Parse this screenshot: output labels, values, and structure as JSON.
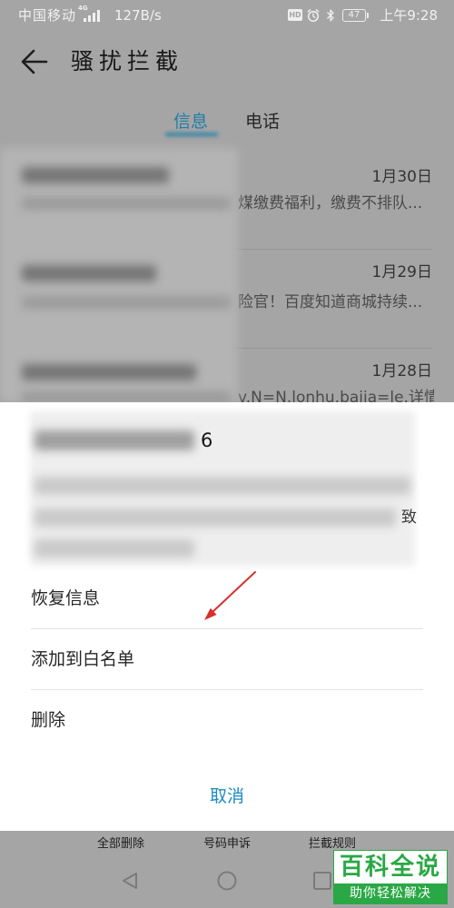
{
  "status_bar": {
    "carrier": "中国移动",
    "network": "4G",
    "speed": "127B/s",
    "hd_label": "HD",
    "battery": "47",
    "time": "上午9:28"
  },
  "header": {
    "title": "骚扰拦截"
  },
  "tabs": [
    {
      "label": "信息",
      "active": true
    },
    {
      "label": "电话",
      "active": false
    }
  ],
  "messages": [
    {
      "date": "1月30日",
      "preview": "煤缴费福利，缴费不排队..."
    },
    {
      "date": "1月29日",
      "preview": "险官！百度知道商城持续..."
    },
    {
      "date": "1月28日",
      "preview": "v.N=N.lonhu.baija=le.详情..."
    }
  ],
  "sheet": {
    "title_fragment": "6",
    "body_fragment": "致",
    "options": [
      {
        "label": "恢复信息"
      },
      {
        "label": "添加到白名单"
      },
      {
        "label": "删除"
      }
    ],
    "cancel_label": "取消"
  },
  "toolbar": {
    "items": [
      {
        "label": "全部删除"
      },
      {
        "label": "号码申诉"
      },
      {
        "label": "拦截规则"
      }
    ]
  },
  "watermark": {
    "brand": "百科全说",
    "slogan": "助你轻松解决"
  },
  "icons": {
    "back": "back-arrow-icon",
    "signal": "signal-icon",
    "hd": "hd-icon",
    "alarm": "alarm-icon",
    "bluetooth": "bluetooth-icon",
    "battery": "battery-icon",
    "annotation": "red-arrow-annotation",
    "nav_back": "nav-back-icon",
    "nav_home": "nav-home-icon",
    "nav_recent": "nav-recent-icon"
  },
  "colors": {
    "accent": "#1d8bc0",
    "tab_active": "#1e7ea9",
    "annotation": "#d8302b",
    "watermark_green": "#2aa845",
    "dim_background": "#a5a5a5"
  }
}
